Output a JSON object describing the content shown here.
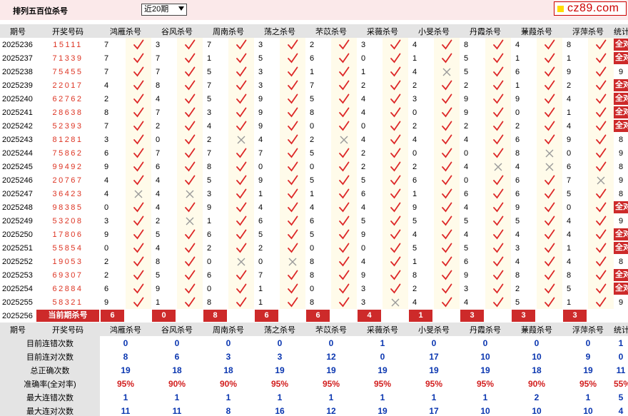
{
  "header": {
    "title": "排列五百位杀号",
    "period_select": "近20期",
    "logo": "cz89.com"
  },
  "table": {
    "headers": [
      "期号",
      "开奖号码",
      "鸿雁杀号",
      "谷风杀号",
      "周南杀号",
      "荡之杀号",
      "芣苡杀号",
      "采薇杀号",
      "小旻杀号",
      "丹霞杀号",
      "蒹葭杀号",
      "浮萍杀号",
      "统计"
    ],
    "rows": [
      {
        "issue": "2025236",
        "draw": "15111",
        "kills": [
          7,
          3,
          7,
          3,
          2,
          3,
          4,
          8,
          4,
          8
        ],
        "hit": [
          1,
          1,
          1,
          1,
          1,
          1,
          1,
          1,
          1,
          1
        ],
        "stat": "全对"
      },
      {
        "issue": "2025237",
        "draw": "71339",
        "kills": [
          7,
          7,
          1,
          5,
          6,
          0,
          1,
          5,
          1,
          1
        ],
        "hit": [
          1,
          1,
          1,
          1,
          1,
          1,
          1,
          1,
          1,
          1
        ],
        "stat": "全对"
      },
      {
        "issue": "2025238",
        "draw": "75455",
        "kills": [
          7,
          7,
          5,
          3,
          1,
          1,
          4,
          5,
          6,
          9
        ],
        "hit": [
          1,
          1,
          1,
          1,
          1,
          1,
          0,
          1,
          1,
          1
        ],
        "stat": "9"
      },
      {
        "issue": "2025239",
        "draw": "22017",
        "kills": [
          4,
          8,
          7,
          3,
          7,
          2,
          2,
          2,
          1,
          2
        ],
        "hit": [
          1,
          1,
          1,
          1,
          1,
          1,
          1,
          1,
          1,
          1
        ],
        "stat": "全对"
      },
      {
        "issue": "2025240",
        "draw": "62762",
        "kills": [
          2,
          4,
          5,
          9,
          5,
          4,
          3,
          9,
          9,
          4
        ],
        "hit": [
          1,
          1,
          1,
          1,
          1,
          1,
          1,
          1,
          1,
          1
        ],
        "stat": "全对"
      },
      {
        "issue": "2025241",
        "draw": "28638",
        "kills": [
          8,
          7,
          3,
          9,
          8,
          4,
          0,
          9,
          0,
          1
        ],
        "hit": [
          1,
          1,
          1,
          1,
          1,
          1,
          1,
          1,
          1,
          1
        ],
        "stat": "全对"
      },
      {
        "issue": "2025242",
        "draw": "52393",
        "kills": [
          7,
          2,
          4,
          9,
          0,
          0,
          2,
          2,
          2,
          4
        ],
        "hit": [
          1,
          1,
          1,
          1,
          1,
          1,
          1,
          1,
          1,
          1
        ],
        "stat": "全对"
      },
      {
        "issue": "2025243",
        "draw": "81281",
        "kills": [
          3,
          0,
          2,
          4,
          2,
          4,
          4,
          4,
          6,
          9
        ],
        "hit": [
          1,
          1,
          0,
          1,
          0,
          1,
          1,
          1,
          1,
          1
        ],
        "stat": "8"
      },
      {
        "issue": "2025244",
        "draw": "75862",
        "kills": [
          6,
          7,
          7,
          7,
          5,
          2,
          0,
          0,
          8,
          0
        ],
        "hit": [
          1,
          1,
          1,
          1,
          1,
          1,
          1,
          1,
          0,
          1
        ],
        "stat": "9"
      },
      {
        "issue": "2025245",
        "draw": "99492",
        "kills": [
          9,
          6,
          8,
          0,
          0,
          2,
          2,
          4,
          4,
          6
        ],
        "hit": [
          1,
          1,
          1,
          1,
          1,
          1,
          1,
          0,
          0,
          1
        ],
        "stat": "8"
      },
      {
        "issue": "2025246",
        "draw": "20767",
        "kills": [
          4,
          4,
          5,
          9,
          5,
          5,
          6,
          0,
          6,
          7
        ],
        "hit": [
          1,
          1,
          1,
          1,
          1,
          1,
          1,
          1,
          1,
          0
        ],
        "stat": "9"
      },
      {
        "issue": "2025247",
        "draw": "36423",
        "kills": [
          4,
          4,
          3,
          1,
          1,
          6,
          1,
          6,
          6,
          5
        ],
        "hit": [
          0,
          0,
          1,
          1,
          1,
          1,
          1,
          1,
          1,
          1
        ],
        "stat": "8"
      },
      {
        "issue": "2025248",
        "draw": "98385",
        "kills": [
          0,
          4,
          9,
          4,
          4,
          4,
          9,
          4,
          9,
          0
        ],
        "hit": [
          1,
          1,
          1,
          1,
          1,
          1,
          1,
          1,
          1,
          1
        ],
        "stat": "全对"
      },
      {
        "issue": "2025249",
        "draw": "53208",
        "kills": [
          3,
          2,
          1,
          6,
          6,
          5,
          5,
          5,
          5,
          4
        ],
        "hit": [
          1,
          0,
          1,
          1,
          1,
          1,
          1,
          1,
          1,
          1
        ],
        "stat": "9"
      },
      {
        "issue": "2025250",
        "draw": "17806",
        "kills": [
          9,
          5,
          6,
          5,
          5,
          9,
          4,
          4,
          4,
          4
        ],
        "hit": [
          1,
          1,
          1,
          1,
          1,
          1,
          1,
          1,
          1,
          1
        ],
        "stat": "全对"
      },
      {
        "issue": "2025251",
        "draw": "55854",
        "kills": [
          0,
          4,
          2,
          2,
          0,
          0,
          5,
          5,
          3,
          1
        ],
        "hit": [
          1,
          1,
          1,
          1,
          1,
          1,
          1,
          1,
          1,
          1
        ],
        "stat": "全对"
      },
      {
        "issue": "2025252",
        "draw": "19053",
        "kills": [
          2,
          8,
          0,
          0,
          8,
          4,
          1,
          6,
          4,
          4
        ],
        "hit": [
          1,
          1,
          0,
          0,
          1,
          1,
          1,
          1,
          1,
          1
        ],
        "stat": "8"
      },
      {
        "issue": "2025253",
        "draw": "69307",
        "kills": [
          2,
          5,
          6,
          7,
          8,
          9,
          8,
          9,
          8,
          8
        ],
        "hit": [
          1,
          1,
          1,
          1,
          1,
          1,
          1,
          1,
          1,
          1
        ],
        "stat": "全对"
      },
      {
        "issue": "2025254",
        "draw": "62884",
        "kills": [
          6,
          9,
          0,
          1,
          0,
          3,
          2,
          3,
          2,
          5
        ],
        "hit": [
          1,
          1,
          1,
          1,
          1,
          1,
          1,
          1,
          1,
          1
        ],
        "stat": "全对"
      },
      {
        "issue": "2025255",
        "draw": "58321",
        "kills": [
          9,
          1,
          8,
          1,
          8,
          3,
          4,
          4,
          5,
          1
        ],
        "hit": [
          1,
          1,
          1,
          1,
          1,
          0,
          1,
          1,
          1,
          1
        ],
        "stat": "9"
      }
    ],
    "current": {
      "issue": "2025256",
      "label": "当前期杀号",
      "kills": [
        6,
        0,
        8,
        6,
        6,
        4,
        1,
        3,
        3,
        3
      ]
    },
    "stats": [
      {
        "label": "目前连错次数",
        "values": [
          "0",
          "0",
          "0",
          "0",
          "0",
          "1",
          "0",
          "0",
          "0",
          "0",
          "1"
        ],
        "pct": false
      },
      {
        "label": "目前连对次数",
        "values": [
          "8",
          "6",
          "3",
          "3",
          "12",
          "0",
          "17",
          "10",
          "10",
          "9",
          "0"
        ],
        "pct": false
      },
      {
        "label": "总正确次数",
        "values": [
          "19",
          "18",
          "18",
          "19",
          "19",
          "19",
          "19",
          "19",
          "18",
          "19",
          "11"
        ],
        "pct": false
      },
      {
        "label": "准确率(全对率)",
        "values": [
          "95%",
          "90%",
          "90%",
          "95%",
          "95%",
          "95%",
          "95%",
          "95%",
          "90%",
          "95%",
          "55%"
        ],
        "pct": true
      },
      {
        "label": "最大连错次数",
        "values": [
          "1",
          "1",
          "1",
          "1",
          "1",
          "1",
          "1",
          "1",
          "2",
          "1",
          "5"
        ],
        "pct": false
      },
      {
        "label": "最大连对次数",
        "values": [
          "11",
          "11",
          "8",
          "16",
          "12",
          "19",
          "17",
          "10",
          "10",
          "10",
          "4"
        ],
        "pct": false
      }
    ]
  },
  "colors": {
    "accent_red": "#cd2a2a",
    "stat_blue": "#0a36b0",
    "mark_bg": "#fffbea",
    "header_bg": "#e4e4e4",
    "topbar_bg": "#fbe9ea"
  },
  "icons": {
    "hit": "check-mark-icon",
    "miss": "cross-mark-icon"
  }
}
